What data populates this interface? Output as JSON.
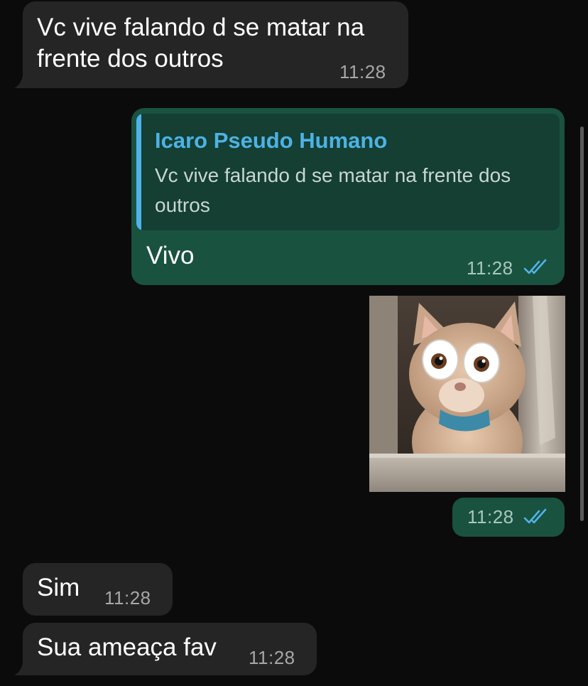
{
  "messages": [
    {
      "direction": "incoming",
      "text": "Vc vive falando d se matar na\nfrente dos outros",
      "time": "11:28"
    },
    {
      "direction": "outgoing",
      "reply_to": {
        "author": "Icaro Pseudo Humano",
        "text": "Vc vive falando d se matar na frente dos\noutros"
      },
      "text": "Vivo",
      "time": "11:28",
      "status": "read"
    },
    {
      "direction": "outgoing",
      "type": "image",
      "image_description": "cat-with-googly-eyes",
      "time": "11:28",
      "status": "read"
    },
    {
      "direction": "incoming",
      "text": "Sim",
      "time": "11:28"
    },
    {
      "direction": "incoming",
      "text": "Sua ameaça fav",
      "time": "11:28"
    }
  ],
  "colors": {
    "background": "#0b0b0b",
    "incoming_bubble": "#252525",
    "outgoing_bubble": "#1a5240",
    "quote_bar": "#4fb3e8",
    "read_ticks": "#4fb3e8"
  }
}
